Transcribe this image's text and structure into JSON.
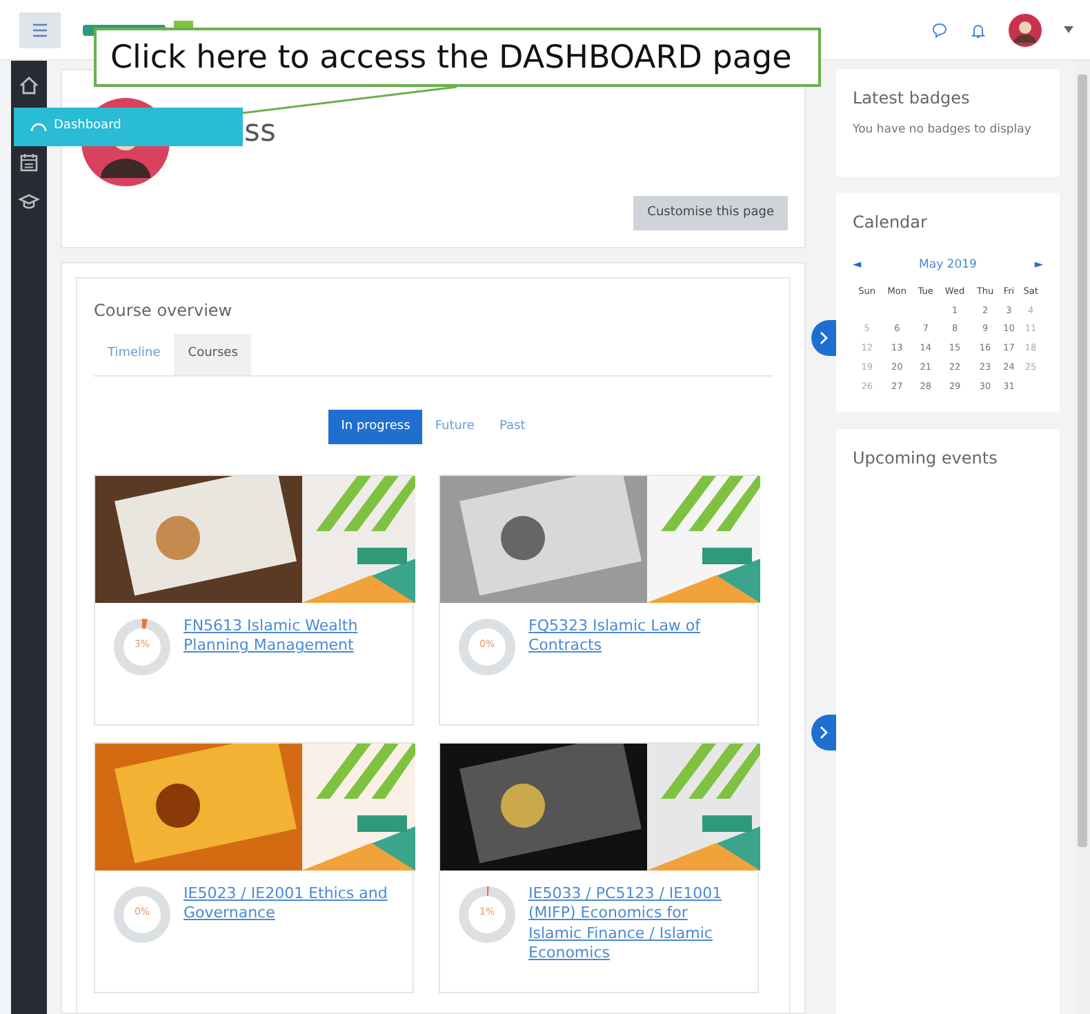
{
  "callout": {
    "text": "Click here to access the DASHBOARD page"
  },
  "sidebar": {
    "items": [
      {
        "kind": "home",
        "selected": false
      },
      {
        "kind": "dashboard",
        "label": "Dashboard",
        "selected": true
      },
      {
        "kind": "calendar",
        "selected": false
      },
      {
        "kind": "courses",
        "selected": false
      }
    ]
  },
  "header": {
    "heading": "ss",
    "button": "Customise this page"
  },
  "course_overview": {
    "title": "Course overview",
    "tabs": [
      {
        "label": "Timeline",
        "selected": false
      },
      {
        "label": "Courses",
        "selected": true
      }
    ],
    "filters": [
      {
        "label": "In progress",
        "selected": true
      },
      {
        "label": "Future",
        "selected": false
      },
      {
        "label": "Past",
        "selected": false
      }
    ],
    "courses": [
      {
        "name": "FN5613 Islamic Wealth Planning Management",
        "progress": "3%",
        "level": 0.03
      },
      {
        "name": "FQ5323 Islamic Law of Contracts",
        "progress": "0%",
        "level": 0
      },
      {
        "name": "IE5023 / IE2001 Ethics and Governance",
        "progress": "0%",
        "level": 0
      },
      {
        "name": "IE5033 / PC5123 / IE1001 (MIFP) Economics for Islamic Finance / Islamic Economics",
        "progress": "1%",
        "level": 0.01
      }
    ]
  },
  "blocks": {
    "badges": {
      "title": "Latest badges",
      "text": "You have no badges to display"
    },
    "calendar": {
      "title": "Calendar",
      "prev": "◄",
      "month": "May 2019",
      "next": "►",
      "weekdays": [
        "Sun",
        "Mon",
        "Tue",
        "Wed",
        "Thu",
        "Fri",
        "Sat"
      ],
      "weeks": [
        [
          "1",
          "2",
          "3",
          "4"
        ],
        [
          "5",
          "6",
          "7",
          "8",
          "9",
          "10",
          "11"
        ],
        [
          "12",
          "13",
          "14",
          "15",
          "16",
          "17",
          "18"
        ],
        [
          "19",
          "20",
          "21",
          "22",
          "23",
          "24",
          "25"
        ],
        [
          "26",
          "27",
          "28",
          "29",
          "30",
          "31"
        ]
      ]
    },
    "upcoming": {
      "title": "Upcoming events"
    }
  }
}
